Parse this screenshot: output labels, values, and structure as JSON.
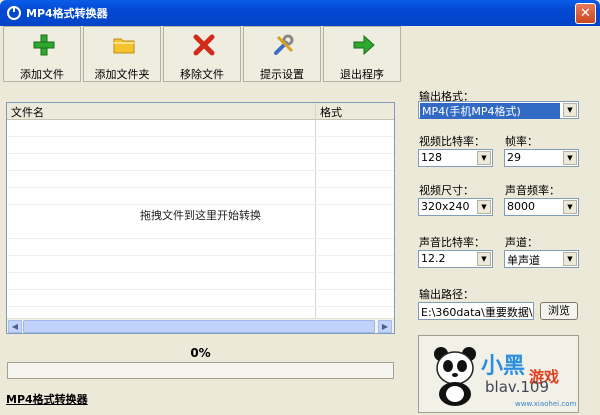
{
  "window": {
    "title": "MP4格式转换器",
    "close": "✕"
  },
  "toolbar": {
    "add_file": "添加文件",
    "add_folder": "添加文件夹",
    "remove_file": "移除文件",
    "tips": "提示设置",
    "exit": "退出程序"
  },
  "list": {
    "col_name": "文件名",
    "col_format": "格式",
    "drop_hint": "拖拽文件到这里开始转换"
  },
  "progress": {
    "text": "0%",
    "value": 0
  },
  "footer_link": "MP4格式转换器",
  "settings": {
    "output_format_label": "输出格式：",
    "output_format_value": "MP4(手机MP4格式)",
    "video_bitrate_label": "视频比特率：",
    "video_bitrate_value": "128",
    "framerate_label": "帧率：",
    "framerate_value": "29",
    "video_size_label": "视频尺寸：",
    "video_size_value": "320x240",
    "audio_rate_label": "声音频率：",
    "audio_rate_value": "8000",
    "audio_bitrate_label": "声音比特率：",
    "audio_bitrate_value": "12.2",
    "channel_label": "声道：",
    "channel_value": "单声道",
    "output_path_label": "输出路径：",
    "output_path_value": "E:\\360data\\重要数据\\桌",
    "browse": "浏览"
  },
  "watermark": {
    "logo": "小黑",
    "logo2": "游戏",
    "text": "blav.109",
    "site": "www.xiaohei.com"
  },
  "colors": {
    "titlebar": "#0348d3",
    "highlight": "#316ac5",
    "progress": "#2db52d"
  },
  "icons": {
    "add_file": "green-plus-icon",
    "add_folder": "folder-icon",
    "remove_file": "red-x-icon",
    "tips": "tools-icon",
    "exit": "green-arrow-icon"
  }
}
